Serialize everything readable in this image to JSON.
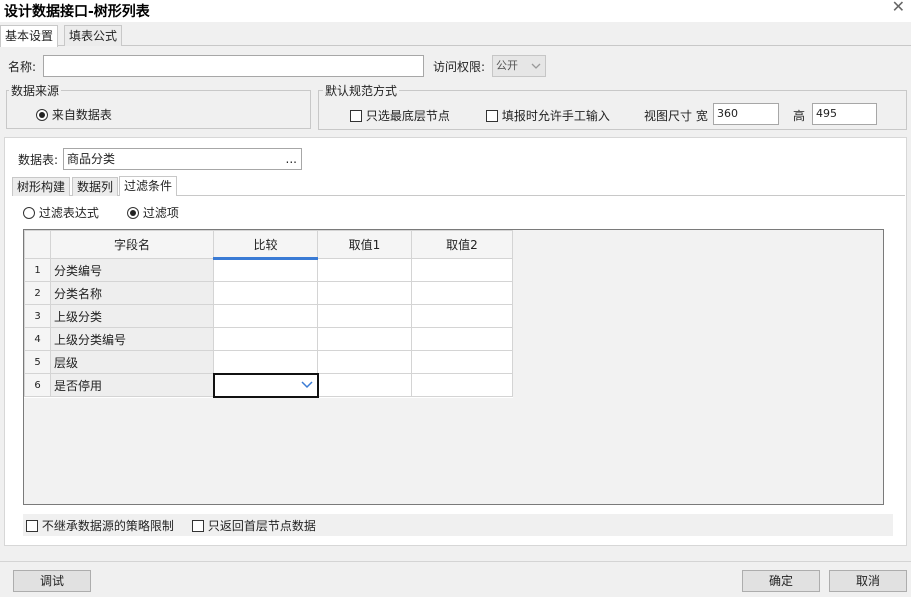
{
  "window": {
    "title": "设计数据接口-树形列表",
    "close_glyph": "✕"
  },
  "top_tabs": [
    {
      "label": "基本设置",
      "active": true
    },
    {
      "label": "填表公式",
      "active": false
    }
  ],
  "name_field": {
    "label": "名称:",
    "value": ""
  },
  "access": {
    "label": "访问权限:",
    "value": "公开"
  },
  "data_source": {
    "legend": "数据来源",
    "option": "来自数据表"
  },
  "default_norm": {
    "legend": "默认规范方式",
    "only_bottom_label": "只选最底层节点",
    "allow_manual_label": "填报时允许手工输入",
    "view_size_label": "视图尺寸 宽",
    "width_value": "360",
    "height_label": "高",
    "height_value": "495"
  },
  "table_field": {
    "label": "数据表:",
    "value": "商品分类",
    "browse": "..."
  },
  "inner_tabs": [
    {
      "label": "树形构建",
      "active": false
    },
    {
      "label": "数据列",
      "active": false
    },
    {
      "label": "过滤条件",
      "active": true
    }
  ],
  "filter_mode": {
    "option_expression": "过滤表达式",
    "option_items": "过滤项",
    "selected": "过滤项"
  },
  "grid": {
    "headers": [
      "字段名",
      "比较",
      "取值1",
      "取值2"
    ],
    "rows": [
      {
        "num": "1",
        "field": "分类编号",
        "compare": "",
        "v1": "",
        "v2": ""
      },
      {
        "num": "2",
        "field": "分类名称",
        "compare": "",
        "v1": "",
        "v2": ""
      },
      {
        "num": "3",
        "field": "上级分类",
        "compare": "",
        "v1": "",
        "v2": ""
      },
      {
        "num": "4",
        "field": "上级分类编号",
        "compare": "",
        "v1": "",
        "v2": ""
      },
      {
        "num": "5",
        "field": "层级",
        "compare": "",
        "v1": "",
        "v2": ""
      },
      {
        "num": "6",
        "field": "是否停用",
        "compare": "",
        "v1": "",
        "v2": ""
      }
    ]
  },
  "options": {
    "no_inherit_label": "不继承数据源的策略限制",
    "first_level_only_label": "只返回首层节点数据"
  },
  "buttons": {
    "debug": "调试",
    "ok": "确定",
    "cancel": "取消"
  },
  "colors": {
    "accent": "#3a7bd5"
  }
}
